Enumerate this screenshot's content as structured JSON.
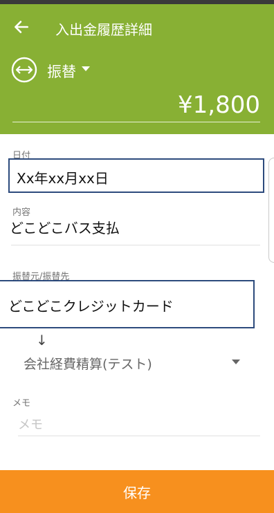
{
  "header": {
    "title": "入出金履歴詳細",
    "type_label": "振替",
    "amount": "¥1,800"
  },
  "fields": {
    "date_label": "日付",
    "date_value": "Xx年xx月xx日",
    "content_label": "内容",
    "content_value": "どこどこバス支払",
    "transfer_label": "振替元/振替先",
    "transfer_from": "どこどこクレジットカード",
    "transfer_arrow": "↓",
    "transfer_to": "会社経費精算(テスト)",
    "memo_label": "メモ",
    "memo_placeholder": "メモ"
  },
  "footer": {
    "save_label": "保存"
  },
  "colors": {
    "header": "#88b034",
    "save_button": "#f7901e",
    "field_border": "#2c4a7c"
  },
  "icons": [
    "back-arrow-icon",
    "transfer-icon",
    "caret-down-icon"
  ]
}
